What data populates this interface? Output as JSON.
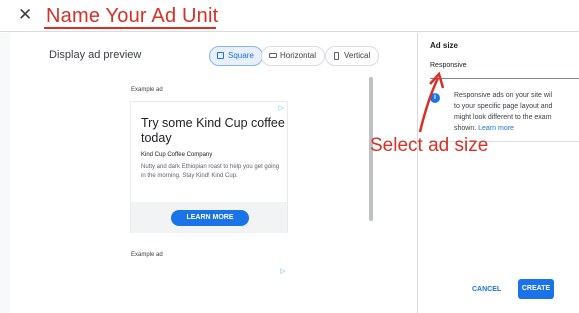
{
  "header": {
    "close_glyph": "✕",
    "title": "Name Your Ad Unit"
  },
  "preview": {
    "title": "Display ad preview",
    "tabs": [
      {
        "label": "Square",
        "selected": true
      },
      {
        "label": "Horizontal",
        "selected": false
      },
      {
        "label": "Vertical",
        "selected": false
      }
    ],
    "example_label_1": "Example ad",
    "example_label_2": "Example ad",
    "ad": {
      "headline": "Try some Kind Cup coffee today",
      "advertiser": "Kind Cup Coffee Company",
      "body": "Nutty and dark Ethiopian roast to help you get going in the morning. Stay Kind! Kind Cup.",
      "cta": "LEARN MORE",
      "adchoices_glyph": "▷"
    }
  },
  "panel": {
    "ad_size_label": "Ad size",
    "ad_size_value": "Responsive",
    "info_lines": [
      "Responsive ads on your site wil",
      "to your specific page layout and",
      "might look different to the exam",
      "shown."
    ],
    "learn_more": "Learn more",
    "cancel": "CANCEL",
    "create": "CREATE"
  },
  "annotation": {
    "text": "Select ad size",
    "color": "#d93025"
  },
  "colors": {
    "accent": "#1a73e8",
    "annotation_red": "#d93025"
  }
}
